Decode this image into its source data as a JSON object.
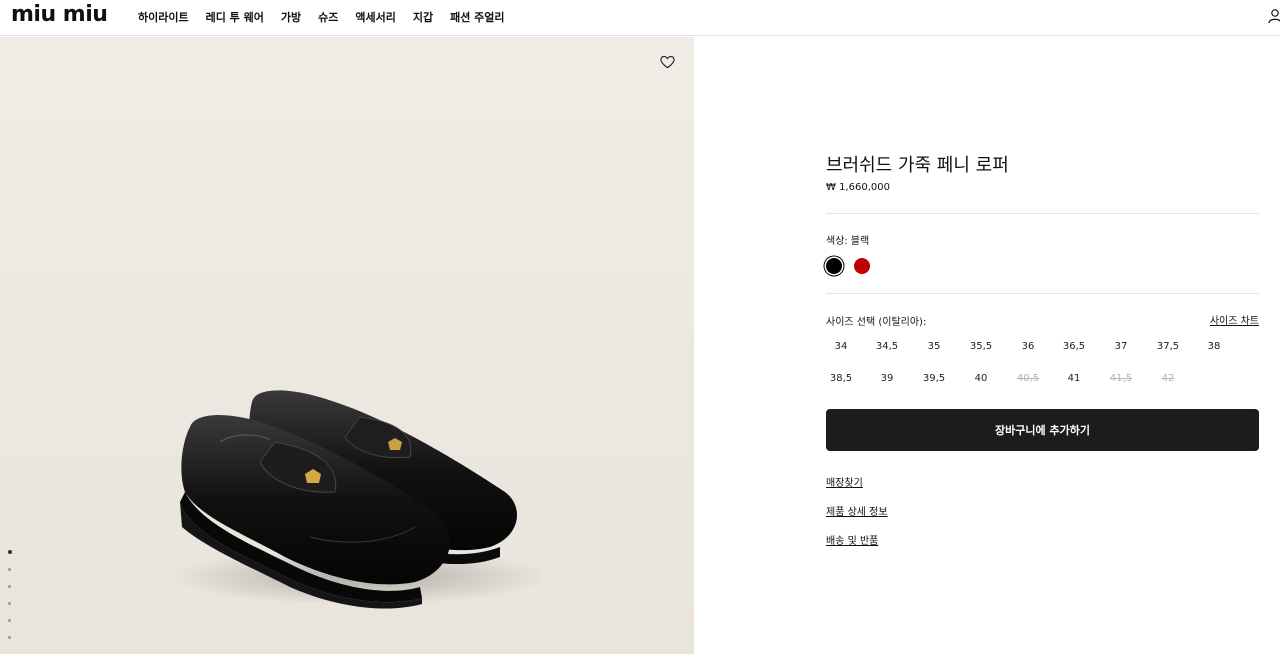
{
  "header": {
    "logo": "miu miu",
    "nav": [
      "하이라이트",
      "레디 투 웨어",
      "가방",
      "슈즈",
      "액세서리",
      "지갑",
      "패션 주얼리"
    ]
  },
  "product": {
    "title": "브러쉬드 가죽 페니 로퍼",
    "price": "₩ 1,660,000",
    "color_label": "색상:",
    "color_value": "블랙",
    "colors": [
      "#000000",
      "#c00000"
    ],
    "size_label": "사이즈 선택 (이탈리아):",
    "size_chart": "사이즈 차트",
    "sizes_row1": [
      "34",
      "34,5",
      "35",
      "35,5",
      "36",
      "36,5",
      "37",
      "37,5",
      "38"
    ],
    "sizes_row2": [
      "38,5",
      "39",
      "39,5",
      "40",
      "40,5",
      "41",
      "41,5",
      "42"
    ],
    "unavailable": [
      "40,5",
      "41,5",
      "42"
    ],
    "add_to_cart": "장바구니에 추가하기",
    "links": [
      "매장찾기",
      "제품 상세 정보",
      "배송 및 반품"
    ]
  },
  "gallery": {
    "image_count": 6,
    "active_index": 0
  }
}
